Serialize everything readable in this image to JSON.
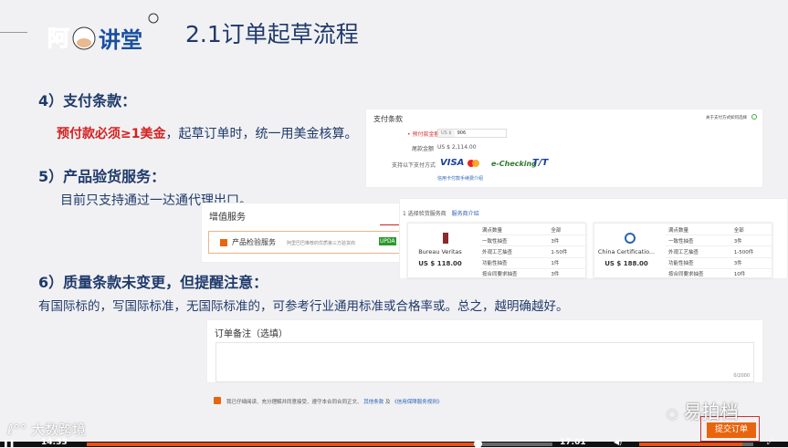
{
  "slide": {
    "title": "2.1订单起草流程",
    "logo_text": "阿讲堂",
    "s4_heading": "4）支付条款：",
    "s4_red": "预付款必须≥1美金",
    "s4_rest": "，起草订单时，统一用美金核算。",
    "s5_heading": "5）产品验货服务：",
    "s5_text": "目前只支持通过一达通代理出口。",
    "s6_heading": "6）质量条款未变更，但提醒注意：",
    "s6_text": "有国际标的，写国际标准，无国际标准的，可参考行业通用标准或合格率或。总之，越明确越好。"
  },
  "payment": {
    "title": "支付条款",
    "help": "关于支付方式如何选择",
    "prepay_label": "• 预付款金额",
    "currency": "US $",
    "prepay_value": "906",
    "balance_label": "尾款金额",
    "balance_value": "US $ 2,114.00",
    "methods_label": "支持以下支付方式",
    "methods": [
      "VISA",
      "MasterCard",
      "e-Checking",
      "T/T"
    ],
    "fee_link": "信用卡付款手续费介绍"
  },
  "value_added": {
    "title": "增值服务",
    "service": "产品检验服务",
    "desc": "阿里巴巴推荐的优质第三方验货商",
    "badge": "UPDA"
  },
  "inspection": {
    "step": "1 选择验货服务商",
    "intro_link": "服务商介绍",
    "providers": [
      {
        "name": "Bureau Veritas",
        "price": "US $ 118.00",
        "rows": [
          [
            "满点数量",
            "全部"
          ],
          [
            "一致性抽查",
            "3件"
          ],
          [
            "外观工艺抽查",
            "1-50件"
          ],
          [
            "功能性抽查",
            "1件"
          ],
          [
            "按合同要求抽查",
            "3件"
          ]
        ]
      },
      {
        "name": "China Certificatio...",
        "price": "US $ 188.00",
        "rows": [
          [
            "满点数量",
            "全部"
          ],
          [
            "一致性抽查",
            "3件"
          ],
          [
            "外观工艺抽查",
            "1-500件"
          ],
          [
            "功能性抽查",
            "3件"
          ],
          [
            "按合同要求抽查",
            "10件"
          ]
        ]
      }
    ]
  },
  "notes": {
    "title": "订单备注（选填）",
    "counter": "0/2000",
    "agree_text": "我已仔细阅读、充分理解并同意接受、遵守本合同合同正文、",
    "link1": "其他条款",
    "and": "及",
    "link2": "《信用保障服务规则》",
    "agreed": true,
    "submit": "提交订单"
  },
  "watermarks": {
    "left": "大数跨境",
    "right": "易拍档"
  },
  "player": {
    "current": "14:33",
    "total": "17:01",
    "progress": 0.84,
    "volume": 0.9
  }
}
